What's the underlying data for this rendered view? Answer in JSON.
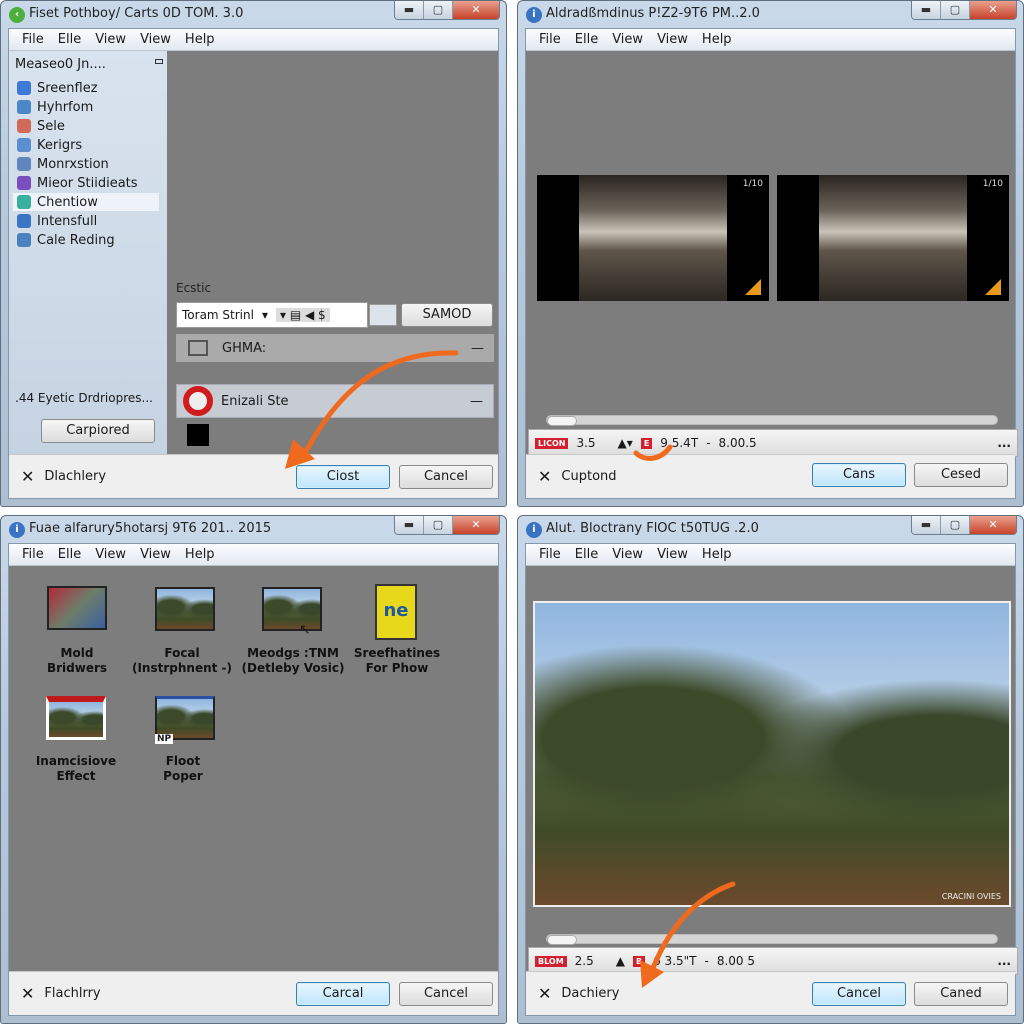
{
  "menu": [
    "File",
    "Elle",
    "View",
    "View",
    "Help"
  ],
  "w1": {
    "title": "Fiset Pothboy/ Carts 0D TOM. 3.0",
    "sidebar_header": "Measeo0 Jn....",
    "sidebar_items": [
      {
        "label": "Sreenflez",
        "color": "#3d7bd8"
      },
      {
        "label": "Hyhrfom",
        "color": "#4a86c8"
      },
      {
        "label": "Sele",
        "color": "#d06a5a"
      },
      {
        "label": "Kerigrs",
        "color": "#5b8fd0"
      },
      {
        "label": "Monrxstion",
        "color": "#5f86bf"
      },
      {
        "label": "Mieor Stiidieats",
        "color": "#7a4fc0"
      },
      {
        "label": "Chentiow",
        "color": "#3bb0a0",
        "selected": true
      },
      {
        "label": "Intensfull",
        "color": "#3c74c4"
      },
      {
        "label": "Cale Reding",
        "color": "#4a80c0"
      }
    ],
    "sidebar_footer": ".44 Eyetic Drdriopres...",
    "sidebar_button": "Carpiored",
    "panel_label": "Ecstic",
    "dropdown_value": "Toram Strinl",
    "action_button": "SAMOD",
    "row1": "GHMA:",
    "row2": "Enizali Ste",
    "footer_label": "Dlachlery",
    "ok": "Ciost",
    "cancel": "Cancel"
  },
  "w2": {
    "title": "Aldradßmdinus P!Z2-9T6 PM..2.0",
    "badge": "1/10",
    "status": {
      "tag": "LICON",
      "v1": "3.5",
      "v2": "9.5.4T",
      "sep": "-",
      "v3": "8.00.5",
      "more": "..."
    },
    "footer_label": "Cuptond",
    "ok": "Cans",
    "cancel": "Cesed"
  },
  "w3": {
    "title": "Fuae alfarury5hotarsj 9T6 201.. 2015",
    "items": [
      {
        "l1": "Mold",
        "l2": "Bridwers"
      },
      {
        "l1": "Focal",
        "l2": "(Instrphnent -)"
      },
      {
        "l1": "Meodgs :TNM",
        "l2": "(Detleby Vosic)"
      },
      {
        "l1": "Sreefhatines",
        "l2": "For Phow"
      },
      {
        "l1": "Inamcisiove",
        "l2": "Effect"
      },
      {
        "l1": "Floot",
        "l2": "Poper"
      }
    ],
    "logo_text": "ne",
    "badge_text": "NP",
    "footer_label": "Flachlrry",
    "ok": "Carcal",
    "cancel": "Cancel"
  },
  "w4": {
    "title": "Alut. Bloctrany FlOC t50TUG .2.0",
    "watermark": "CRACINI OVIES",
    "status": {
      "tag": "BLOM",
      "v1": "2.5",
      "v2": "6 3.5\"T",
      "sep": "-",
      "v3": "8.00 5",
      "more": "..."
    },
    "footer_label": "Dachiery",
    "ok": "Cancel",
    "cancel": "Caned"
  },
  "colors": {
    "arrow": "#f06a1e",
    "red": "#d3202e"
  }
}
